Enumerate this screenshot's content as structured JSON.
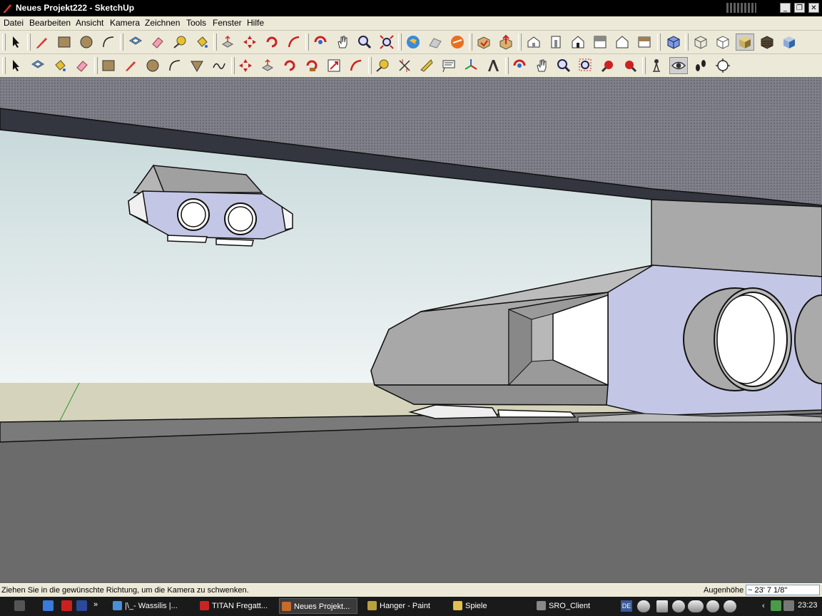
{
  "window": {
    "title": "Neues Projekt222 - SketchUp",
    "buttons": {
      "minimize": "_",
      "restore": "❐",
      "close": "✕"
    }
  },
  "menu": {
    "items": [
      "Datei",
      "Bearbeiten",
      "Ansicht",
      "Kamera",
      "Zeichnen",
      "Tools",
      "Fenster",
      "Hilfe"
    ]
  },
  "toolbar1": {
    "tools": [
      "select-icon",
      "pencil-icon",
      "rectangle-icon",
      "circle-icon",
      "arc-icon",
      "offset-icon",
      "eraser-icon",
      "tape-measure-icon",
      "paint-bucket-icon",
      "push-pull-icon",
      "move-icon",
      "rotate-icon",
      "follow-me-icon",
      "orbit-icon",
      "pan-icon",
      "zoom-icon",
      "zoom-extents-icon",
      "get-location-icon",
      "toggle-terrain-icon",
      "photo-textures-icon",
      "get-models-icon",
      "share-model-icon",
      "iso-view-icon",
      "front-view-icon",
      "top-view-icon",
      "right-view-icon",
      "back-view-icon",
      "left-view-icon",
      "xray-icon",
      "wireframe-icon",
      "hidden-line-icon",
      "shaded-icon",
      "shaded-textures-icon",
      "monochrome-icon"
    ]
  },
  "toolbar2": {
    "tools": [
      "select-icon",
      "offset-icon",
      "paint-bucket-icon",
      "eraser-icon",
      "rectangle-icon",
      "line-icon",
      "circle-icon",
      "arc-icon",
      "polygon-icon",
      "freehand-icon",
      "move-icon",
      "push-pull-icon",
      "rotate-icon",
      "follow-me-icon",
      "scale-icon",
      "offset-tool-icon",
      "tape-measure-icon",
      "dimension-icon",
      "protractor-icon",
      "text-icon",
      "axes-icon",
      "3d-text-icon",
      "orbit-icon",
      "pan-icon",
      "zoom-icon",
      "zoom-window-icon",
      "previous-view-icon",
      "next-view-icon",
      "position-camera-icon",
      "look-around-icon",
      "walk-icon",
      "section-plane-icon"
    ]
  },
  "status": {
    "text": "Ziehen Sie in die gewünschte Richtung, um die Kamera zu schwenken.",
    "vcb_label": "Augenhöhe",
    "vcb_value": "~ 23' 7 1/8\""
  },
  "taskbar": {
    "tasks": [
      {
        "label": "|\\_- Wassilis |...",
        "icon_color": "#4a8fd8"
      },
      {
        "label": "TITAN Fregatt...",
        "icon_color": "#cc2222"
      },
      {
        "label": "Neues Projekt...",
        "icon_color": "#c86a2a"
      },
      {
        "label": "Hanger - Paint",
        "icon_color": "#b8a040"
      },
      {
        "label": "Spiele",
        "icon_color": "#e0c050"
      },
      {
        "label": "SRO_Client",
        "icon_color": "#888888"
      }
    ],
    "language": "DE",
    "clock": "23:23"
  },
  "colors": {
    "sky_top": "#c8d8d8",
    "sky_bottom": "#eef2f2",
    "ground": "#6b6b6b",
    "face_front": "#c4c6e6",
    "face_grey": "#a8a8a8",
    "ceiling": "#7a7a82"
  }
}
